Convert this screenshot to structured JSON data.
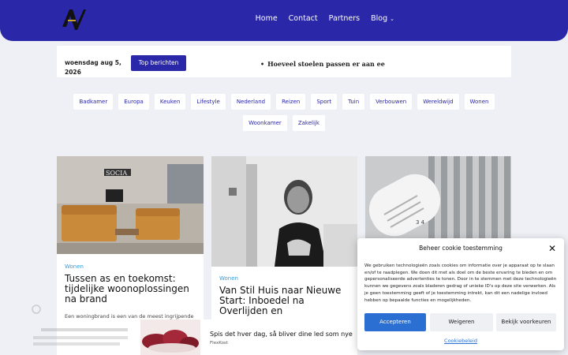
{
  "header": {
    "logo_alt": "AV logo",
    "nav": [
      "Home",
      "Contact",
      "Partners",
      "Blog"
    ]
  },
  "topbar": {
    "date": "woensdag aug 5, 2026",
    "top_button": "Top berichten",
    "ticker": "Hoeveel stoelen passen er aan ee"
  },
  "tags": [
    "Badkamer",
    "Europa",
    "Keuken",
    "Lifestyle",
    "Nederland",
    "Reizen",
    "Sport",
    "Tuin",
    "Verbouwen",
    "Wereldwijd",
    "Wonen",
    "Woonkamer",
    "Zakelijk"
  ],
  "cards": [
    {
      "category": "Wonen",
      "title": "Tussen as en toekomst: tijdelijke woonoplossingen na brand",
      "excerpt": "Een woningbrand is een van de meest ingrijpende"
    },
    {
      "category": "Wonen",
      "title": "Van Stil Huis naar Nieuwe Start: Inboedel na Overlijden en"
    },
    {}
  ],
  "cookie": {
    "title": "Beheer cookie toestemming",
    "body": "We gebruiken technologieën zoals cookies om informatie over je apparaat op te slaan en/of te raadplegen. We doen dit met als doel om de beste ervaring te bieden en om gepersonaliseerde advertenties te tonen. Door in te stemmen met deze technologieën kunnen we gegevens zoals bladeren gedrag of unieke ID's op deze site verwerken. Als je geen toestemming geeft of je toestemming intrekt, kan dit een nadelige invloed hebben op bepaalde functies en mogelijkheden.",
    "accept": "Accepteren",
    "deny": "Weigeren",
    "prefs": "Bekijk voorkeuren",
    "link": "Cookiebeleid"
  },
  "ad": {
    "title": "Spis det hver dag, så bliver dine led som nye",
    "source": "FlexKost"
  },
  "colors": {
    "brand": "#2a27a8",
    "accent": "#3a9bd5",
    "accept": "#2a6fd1"
  }
}
